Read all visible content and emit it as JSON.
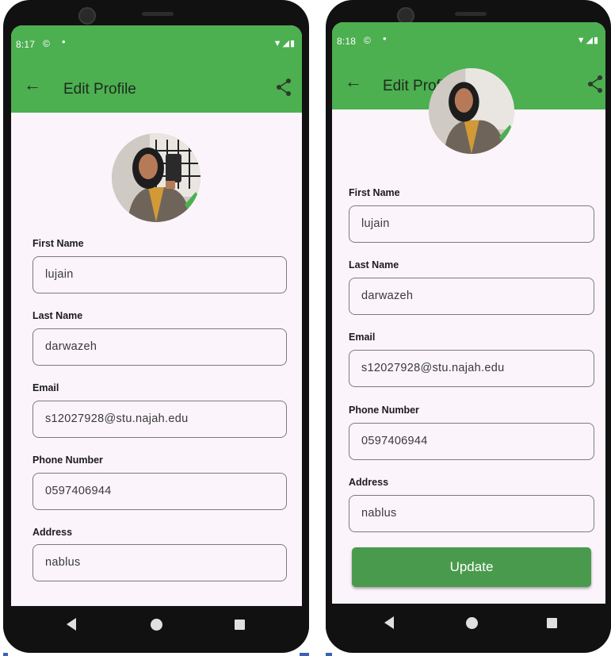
{
  "left_screen": {
    "status": {
      "time": "8:17",
      "whatsapp_icon": "©",
      "dot": "•",
      "indicators": "▼◢▮"
    },
    "appbar": {
      "title": "Edit Profile",
      "back_icon": "←"
    },
    "fields": [
      {
        "label": "First Name",
        "value": "lujain"
      },
      {
        "label": "Last Name",
        "value": "darwazeh"
      },
      {
        "label": "Email",
        "value": "s12027928@stu.najah.edu"
      },
      {
        "label": "Phone Number",
        "value": "0597406944"
      },
      {
        "label": "Address",
        "value": "nablus"
      }
    ]
  },
  "right_screen": {
    "status": {
      "time": "8:18",
      "whatsapp_icon": "©",
      "dot": "•",
      "indicators": "▼◢▮"
    },
    "appbar": {
      "title": "Edit Profile",
      "back_icon": "←"
    },
    "fields": [
      {
        "label": "First Name",
        "value": "lujain"
      },
      {
        "label": "Last Name",
        "value": "darwazeh"
      },
      {
        "label": "Email",
        "value": "s12027928@stu.najah.edu"
      },
      {
        "label": "Phone Number",
        "value": "0597406944"
      },
      {
        "label": "Address",
        "value": "nablus"
      }
    ],
    "update_button": "Update"
  },
  "colors": {
    "accent": "#4caf50",
    "button": "#4a9a4e",
    "background": "#fbf4fa"
  }
}
